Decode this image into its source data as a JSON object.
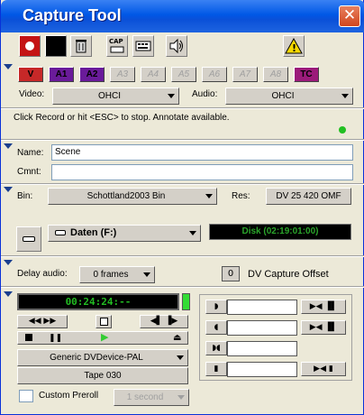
{
  "window": {
    "title": "Capture Tool",
    "close_glyph": "✕"
  },
  "toolbar": {
    "cap_label": "CAP"
  },
  "tracks": [
    {
      "label": "V",
      "state": "on",
      "color": "#c62828"
    },
    {
      "label": "A1",
      "state": "on",
      "color": "#6a1b9a"
    },
    {
      "label": "A2",
      "state": "on",
      "color": "#6a1b9a"
    },
    {
      "label": "A3",
      "state": "off"
    },
    {
      "label": "A4",
      "state": "off"
    },
    {
      "label": "A5",
      "state": "off"
    },
    {
      "label": "A6",
      "state": "off"
    },
    {
      "label": "A7",
      "state": "off"
    },
    {
      "label": "A8",
      "state": "off"
    },
    {
      "label": "TC",
      "state": "on",
      "color": "#9b1b7a"
    }
  ],
  "io": {
    "video_label": "Video:",
    "video_value": "OHCI",
    "audio_label": "Audio:",
    "audio_value": "OHCI"
  },
  "status": {
    "message": "Click Record or hit <ESC> to stop. Annotate available.",
    "indicator_color": "#22c022"
  },
  "clip": {
    "name_label": "Name:",
    "name_value": "Scene",
    "comment_label": "Cmnt:",
    "comment_value": ""
  },
  "bin": {
    "label": "Bin:",
    "value": "Schottland2003 Bin",
    "res_label": "Res:",
    "res_value": "DV 25 420 OMF"
  },
  "disk": {
    "target": "Daten (F:)",
    "remaining": "Disk (02:19:01:00)"
  },
  "delay": {
    "label": "Delay audio:",
    "value": "0 frames",
    "offset_value": "0",
    "offset_label": "DV Capture Offset"
  },
  "deck": {
    "timecode": "00:24:24:--",
    "device": "Generic DVDevice-PAL",
    "tape": "Tape 030",
    "preroll_label": "Custom Preroll",
    "preroll_value": "1 second",
    "preroll_checked": false
  },
  "colors": {
    "accent": "#0058e6",
    "timecode_bg": "#000000",
    "timecode_fg": "#33cc33",
    "record_red": "#cc0000"
  }
}
